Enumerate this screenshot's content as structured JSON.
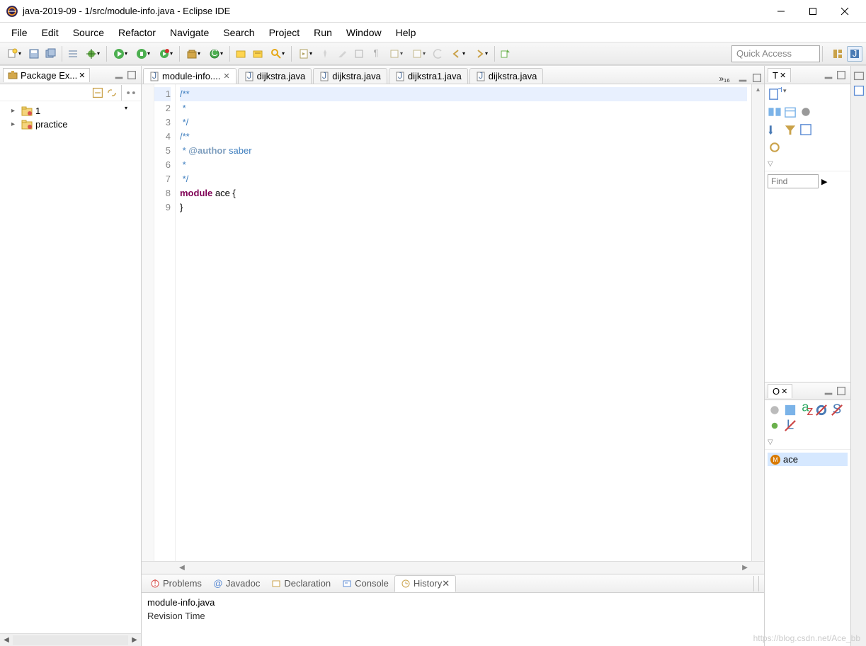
{
  "window": {
    "title": "java-2019-09 - 1/src/module-info.java - Eclipse IDE"
  },
  "menu": [
    "File",
    "Edit",
    "Source",
    "Refactor",
    "Navigate",
    "Search",
    "Project",
    "Run",
    "Window",
    "Help"
  ],
  "toolbar": {
    "quick_access_placeholder": "Quick Access"
  },
  "package_explorer": {
    "title": "Package Ex...",
    "items": [
      {
        "label": "1"
      },
      {
        "label": "practice"
      }
    ]
  },
  "editor_tabs": [
    {
      "label": "module-info....",
      "active": true,
      "closeable": true
    },
    {
      "label": "dijkstra.java",
      "active": false
    },
    {
      "label": "dijkstra.java",
      "active": false
    },
    {
      "label": "dijkstra1.java",
      "active": false
    },
    {
      "label": "dijkstra.java",
      "active": false
    }
  ],
  "editor_more": "»₁₆",
  "code": {
    "lines": [
      {
        "n": 1,
        "html": "<span class='c-comm'>/**</span>"
      },
      {
        "n": 2,
        "html": "<span class='c-comm'> * </span>"
      },
      {
        "n": 3,
        "html": "<span class='c-comm'> */</span>"
      },
      {
        "n": 4,
        "html": "<span class='c-comm'>/**</span>"
      },
      {
        "n": 5,
        "html": "<span class='c-comm'> * </span><span class='c-tag'>@author</span><span class='c-comm'> saber</span>"
      },
      {
        "n": 6,
        "html": "<span class='c-comm'> *</span>"
      },
      {
        "n": 7,
        "html": "<span class='c-comm'> */</span>"
      },
      {
        "n": 8,
        "html": "<span class='c-kw'>module</span> ace {"
      },
      {
        "n": 9,
        "html": "}"
      }
    ]
  },
  "bottom_tabs": [
    "Problems",
    "Javadoc",
    "Declaration",
    "Console",
    "History"
  ],
  "bottom_active": "History",
  "history": {
    "file": "module-info.java",
    "columns": "Revision Time"
  },
  "right_top": {
    "title": "T"
  },
  "right_find": "Find",
  "outline": {
    "title": "O",
    "item": "ace"
  },
  "watermark": "https://blog.csdn.net/Ace_bb"
}
